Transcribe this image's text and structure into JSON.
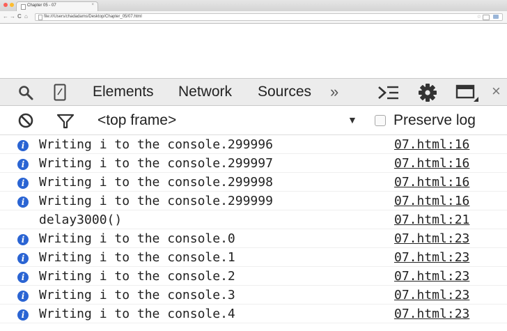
{
  "colors": {
    "info_icon": "#2a64d3",
    "traffic_close": "#fc5f57",
    "traffic_minimize": "#fdbc2e",
    "traffic_zoom": "#28c840"
  },
  "browser": {
    "tab_title": "Chapter 05 - 07",
    "tab_close": "×",
    "url": "file:///Users/chadadams/Desktop/Chapter_05/07.html",
    "nav_back": "←",
    "nav_forward": "→",
    "nav_reload": "C",
    "nav_home": "⌂",
    "bookmark_star": "☆"
  },
  "devtools": {
    "tabs": [
      "Elements",
      "Network",
      "Sources"
    ],
    "more_tabs": "»",
    "icons": [
      "search-icon",
      "device-mode-icon",
      "console-drawer-icon",
      "settings-gear-icon",
      "dock-side-icon",
      "close-icon"
    ],
    "close": "×"
  },
  "console": {
    "frame_selector": "<top frame>",
    "dropdown_arrow": "▼",
    "preserve_log_label": "Preserve log",
    "preserve_log_checked": false,
    "messages": [
      {
        "icon": "info",
        "text": "Writing i to the console.299996",
        "source": "07.html:16"
      },
      {
        "icon": "info",
        "text": "Writing i to the console.299997",
        "source": "07.html:16"
      },
      {
        "icon": "info",
        "text": "Writing i to the console.299998",
        "source": "07.html:16"
      },
      {
        "icon": "info",
        "text": "Writing i to the console.299999",
        "source": "07.html:16"
      },
      {
        "icon": "none",
        "text": "delay3000()",
        "source": "07.html:21"
      },
      {
        "icon": "info",
        "text": "Writing i to the console.0",
        "source": "07.html:23"
      },
      {
        "icon": "info",
        "text": "Writing i to the console.1",
        "source": "07.html:23"
      },
      {
        "icon": "info",
        "text": "Writing i to the console.2",
        "source": "07.html:23"
      },
      {
        "icon": "info",
        "text": "Writing i to the console.3",
        "source": "07.html:23"
      },
      {
        "icon": "info",
        "text": "Writing i to the console.4",
        "source": "07.html:23"
      }
    ]
  }
}
